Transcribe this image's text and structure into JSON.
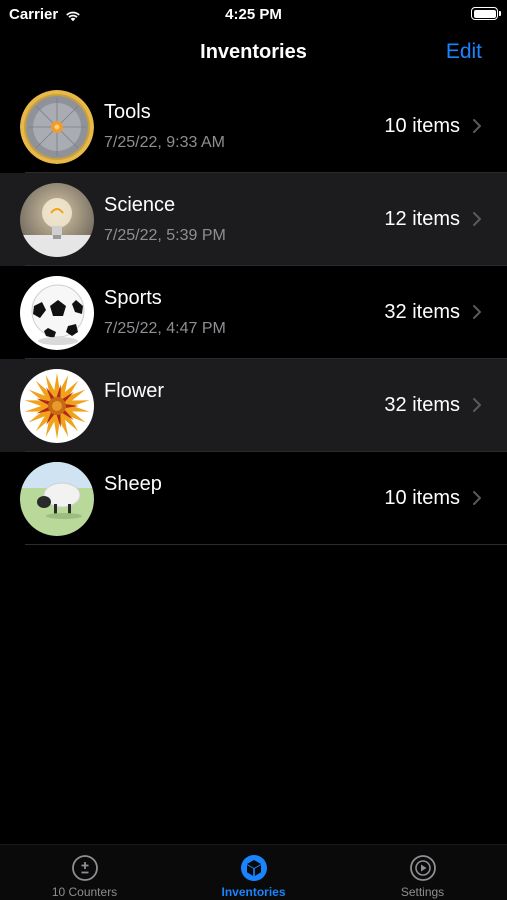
{
  "status": {
    "carrier": "Carrier",
    "time": "4:25 PM"
  },
  "nav": {
    "title": "Inventories",
    "edit_label": "Edit"
  },
  "colors": {
    "accent": "#1a84ff",
    "secondary_text": "#8e8e93",
    "row_alt_bg": "#1c1c1e"
  },
  "inventories": [
    {
      "title": "Tools",
      "date": "7/25/22, 9:33 AM",
      "count": "10 items",
      "thumbnail": "saw-blade-image"
    },
    {
      "title": "Science",
      "date": "7/25/22, 5:39 PM",
      "count": "12 items",
      "thumbnail": "light-bulb-image"
    },
    {
      "title": "Sports",
      "date": "7/25/22, 4:47 PM",
      "count": "32 items",
      "thumbnail": "soccer-ball-image"
    },
    {
      "title": "Flower",
      "date": "",
      "count": "32 items",
      "thumbnail": "flower-image"
    },
    {
      "title": "Sheep",
      "date": "",
      "count": "10 items",
      "thumbnail": "sheep-image"
    }
  ],
  "tabs": [
    {
      "label": "10 Counters",
      "icon": "plus-minus-icon",
      "active": false
    },
    {
      "label": "Inventories",
      "icon": "box-icon",
      "active": true
    },
    {
      "label": "Settings",
      "icon": "play-gear-icon",
      "active": false
    }
  ]
}
